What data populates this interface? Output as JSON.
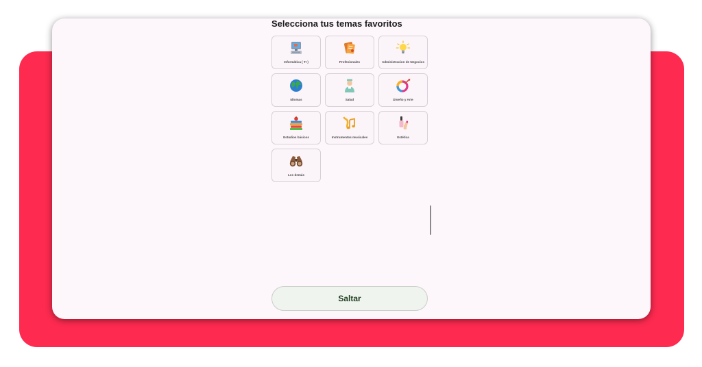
{
  "app": {
    "title": "Selecciona tus temas favoritos",
    "skip_label": "Saltar"
  },
  "topics": [
    {
      "label": "Informática ( TI )",
      "icon": "computer-icon"
    },
    {
      "label": "Profesionales",
      "icon": "briefcase-icon"
    },
    {
      "label": "Administracion de Negocios",
      "icon": "lightbulb-icon"
    },
    {
      "label": "Idiomas",
      "icon": "globe-icon"
    },
    {
      "label": "Salud",
      "icon": "doctor-icon"
    },
    {
      "label": "Diseño y Arte",
      "icon": "color-ring-icon"
    },
    {
      "label": "Estudios básicos",
      "icon": "books-apple-icon"
    },
    {
      "label": "Instrumentos musicales",
      "icon": "music-notes-icon"
    },
    {
      "label": "Estética",
      "icon": "nail-polish-icon"
    },
    {
      "label": "Los demás",
      "icon": "binoculars-icon"
    }
  ],
  "colors": {
    "backdrop": "#fe2a50",
    "screen": "#fdf6fb",
    "tile_border": "#d7d0d6",
    "button_bg": "#eff4ef",
    "button_text": "#1f3d1f"
  }
}
